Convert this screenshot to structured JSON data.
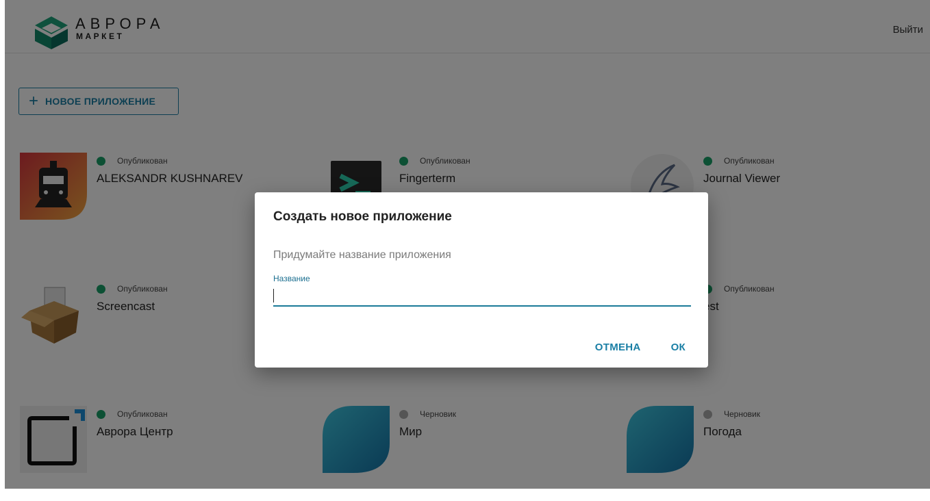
{
  "header": {
    "logo_title": "АВРОРА",
    "logo_subtitle": "МАРКЕТ",
    "logout_label": "Выйти"
  },
  "toolbar": {
    "new_app_label": "НОВОЕ ПРИЛОЖЕНИЕ",
    "new_app_icon": "plus-icon"
  },
  "apps": [
    {
      "name": "ALEKSANDR KUSHNAREV",
      "status": "Опубликован",
      "status_color": "#18a068",
      "icon": "train-icon"
    },
    {
      "name": "Fingerterm",
      "status": "Опубликован",
      "status_color": "#18a068",
      "icon": "terminal-icon"
    },
    {
      "name": "Journal Viewer",
      "status": "Опубликован",
      "status_color": "#18a068",
      "icon": "feather-icon"
    },
    {
      "name": "Screencast",
      "status": "Опубликован",
      "status_color": "#18a068",
      "icon": "box-icon"
    },
    {
      "name": "est",
      "status": "Опубликован",
      "status_color": "#18a068",
      "icon": "blank-icon"
    },
    {
      "name": "Аврора Центр",
      "status": "Опубликован",
      "status_color": "#18a068",
      "icon": "frame-icon"
    },
    {
      "name": "Мир",
      "status": "Черновик",
      "status_color": "#aaaaaa",
      "icon": "leaf-icon"
    },
    {
      "name": "Погода",
      "status": "Черновик",
      "status_color": "#aaaaaa",
      "icon": "leaf-icon"
    }
  ],
  "dialog": {
    "title": "Создать новое приложение",
    "hint": "Придумайте название приложения",
    "field_label": "Название",
    "field_value": "",
    "cancel_label": "ОТМЕНА",
    "ok_label": "ОК"
  },
  "colors": {
    "accent": "#1a7fa5",
    "published": "#18a068",
    "draft": "#aaaaaa"
  }
}
